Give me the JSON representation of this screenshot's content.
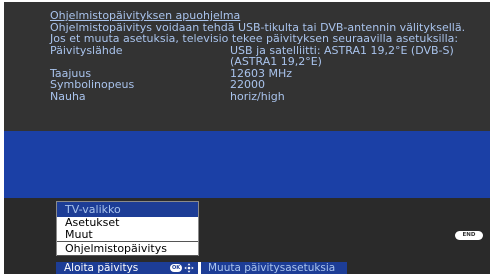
{
  "info": {
    "title": "Ohjelmistopäivityksen apuohjelma",
    "description": "Ohjelmistopäivitys voidaan tehdä USB-tikulta tai DVB-antennin välityksellä. Jos et muuta asetuksia, televisio tekee päivityksen seuraavilla asetuksilla:",
    "rows": [
      {
        "label": "Päivityslähde",
        "value": "USB ja satelliitti: ASTRA1 19,2°E (DVB-S)",
        "value2": "(ASTRA1 19,2°E)"
      },
      {
        "label": "Taajuus",
        "value": "12603 MHz"
      },
      {
        "label": "Symbolinopeus",
        "value": "22000"
      },
      {
        "label": "Nauha",
        "value": "horiz/high"
      }
    ]
  },
  "end_button": {
    "label": "END"
  },
  "menu": {
    "header": "TV-valikko",
    "items": [
      "Asetukset",
      "Muut",
      "Ohjelmistopäivitys"
    ],
    "selected": "Aloita päivitys",
    "ok_label": "OK",
    "action": "Muuta päivitysasetuksia"
  },
  "icons": {
    "ok": "ok-button-icon",
    "nav": "navigation-arrows-icon"
  },
  "colors": {
    "background": "#1b40a6",
    "panel": "#333333",
    "info_text": "#a9c3ec",
    "menu_highlight": "#1d3d96"
  }
}
